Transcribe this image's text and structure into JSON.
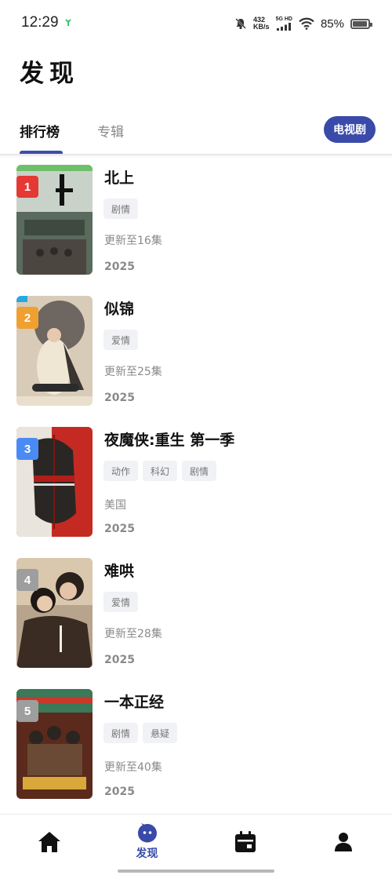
{
  "status_bar": {
    "time": "12:29",
    "net_speed_value": "432",
    "net_speed_unit": "KB/s",
    "network_label": "5G HD",
    "battery_percent": "85%",
    "battery_level": 0.85
  },
  "header": {
    "title": "发现"
  },
  "tabs": {
    "rank_label": "排行榜",
    "album_label": "专辑",
    "type_filter_label": "电视剧"
  },
  "list": [
    {
      "rank": "1",
      "title": "北上",
      "genres": [
        "剧情"
      ],
      "meta": "更新至16集",
      "year": "2025",
      "badge_color": "#e53935"
    },
    {
      "rank": "2",
      "title": "似锦",
      "genres": [
        "爱情"
      ],
      "meta": "更新至25集",
      "year": "2025",
      "badge_color": "#f0a030"
    },
    {
      "rank": "3",
      "title": "夜魔侠:重生 第一季",
      "genres": [
        "动作",
        "科幻",
        "剧情"
      ],
      "meta": "美国",
      "year": "2025",
      "badge_color": "#4a8af4"
    },
    {
      "rank": "4",
      "title": "难哄",
      "genres": [
        "爱情"
      ],
      "meta": "更新至28集",
      "year": "2025",
      "badge_color": "#9e9e9e"
    },
    {
      "rank": "5",
      "title": "一本正经",
      "genres": [
        "剧情",
        "悬疑"
      ],
      "meta": "更新至40集",
      "year": "2025",
      "badge_color": "#9e9e9e"
    }
  ],
  "bottom_nav": {
    "items": [
      {
        "icon": "home-icon",
        "label": ""
      },
      {
        "icon": "discover-icon",
        "label": "发现"
      },
      {
        "icon": "calendar-icon",
        "label": ""
      },
      {
        "icon": "profile-icon",
        "label": ""
      }
    ],
    "active_color": "#3a4aa9"
  },
  "colors": {
    "accent": "#3a4aa9"
  }
}
